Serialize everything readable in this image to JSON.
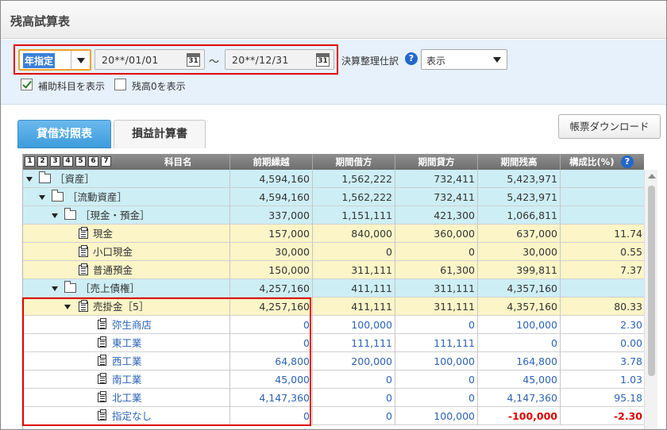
{
  "title": "残高試算表",
  "filter": {
    "period_select": "年指定",
    "date_from": "20**/01/01",
    "date_to": "20**/12/31",
    "calendar_day": "31",
    "tilde": "～",
    "adjust_label": "決算整理仕訳",
    "adjust_select": "表示",
    "show_sub_accounts": {
      "label": "補助科目を表示",
      "checked": true
    },
    "show_zero_balance": {
      "label": "残高0を表示",
      "checked": false
    }
  },
  "tabs": [
    {
      "label": "貸借対照表",
      "active": true
    },
    {
      "label": "損益計算書",
      "active": false
    }
  ],
  "download_button": "帳票ダウンロード",
  "columns": {
    "levels": [
      "1",
      "2",
      "3",
      "4",
      "5",
      "6",
      "7"
    ],
    "account": "科目名",
    "prev": "前期繰越",
    "debit": "期間借方",
    "credit": "期間貸方",
    "balance": "期間残高",
    "ratio": "構成比(%)"
  },
  "rows": [
    {
      "name": "［資産］",
      "level": 0,
      "icon": "folder",
      "prev": "4,594,160",
      "debit": "1,562,222",
      "credit": "732,411",
      "balance": "5,423,971",
      "ratio": ""
    },
    {
      "name": "［流動資産］",
      "level": 1,
      "icon": "folder",
      "prev": "4,594,160",
      "debit": "1,562,222",
      "credit": "732,411",
      "balance": "5,423,971",
      "ratio": ""
    },
    {
      "name": "［現金・預金］",
      "level": 2,
      "icon": "folder",
      "prev": "337,000",
      "debit": "1,151,111",
      "credit": "421,300",
      "balance": "1,066,811",
      "ratio": ""
    },
    {
      "name": "現金",
      "level": 3,
      "icon": "doc",
      "prev": "157,000",
      "debit": "840,000",
      "credit": "360,000",
      "balance": "637,000",
      "ratio": "11.74"
    },
    {
      "name": "小口現金",
      "level": 3,
      "icon": "doc",
      "prev": "30,000",
      "debit": "0",
      "credit": "0",
      "balance": "30,000",
      "ratio": "0.55"
    },
    {
      "name": "普通預金",
      "level": 3,
      "icon": "doc",
      "prev": "150,000",
      "debit": "311,111",
      "credit": "61,300",
      "balance": "399,811",
      "ratio": "7.37"
    },
    {
      "name": "［売上債権］",
      "level": 2,
      "icon": "folder",
      "prev": "4,257,160",
      "debit": "411,111",
      "credit": "311,111",
      "balance": "4,357,160",
      "ratio": ""
    },
    {
      "name": "売掛金［5］",
      "level": 3,
      "icon": "doc",
      "prev": "4,257,160",
      "debit": "411,111",
      "credit": "311,111",
      "balance": "4,357,160",
      "ratio": "80.33"
    },
    {
      "name": "弥生商店",
      "level": 4,
      "icon": "doc",
      "prev": "0",
      "debit": "100,000",
      "credit": "0",
      "balance": "100,000",
      "ratio": "2.30"
    },
    {
      "name": "東工業",
      "level": 4,
      "icon": "doc",
      "prev": "0",
      "debit": "111,111",
      "credit": "111,111",
      "balance": "0",
      "ratio": "0.00"
    },
    {
      "name": "西工業",
      "level": 4,
      "icon": "doc",
      "prev": "64,800",
      "debit": "200,000",
      "credit": "100,000",
      "balance": "164,800",
      "ratio": "3.78"
    },
    {
      "name": "南工業",
      "level": 4,
      "icon": "doc",
      "prev": "45,000",
      "debit": "0",
      "credit": "0",
      "balance": "45,000",
      "ratio": "1.03"
    },
    {
      "name": "北工業",
      "level": 4,
      "icon": "doc",
      "prev": "4,147,360",
      "debit": "0",
      "credit": "0",
      "balance": "4,147,360",
      "ratio": "95.18"
    },
    {
      "name": "指定なし",
      "level": 4,
      "icon": "doc",
      "prev": "0",
      "debit": "0",
      "credit": "100,000",
      "balance": "-100,000",
      "ratio": "-2.30"
    }
  ],
  "colors": {
    "folder_row": "#cdeef5",
    "account_row": "#fbf5c7",
    "sub_text": "#2d63b6",
    "negative": "#e00000",
    "highlight": "#e00000"
  }
}
